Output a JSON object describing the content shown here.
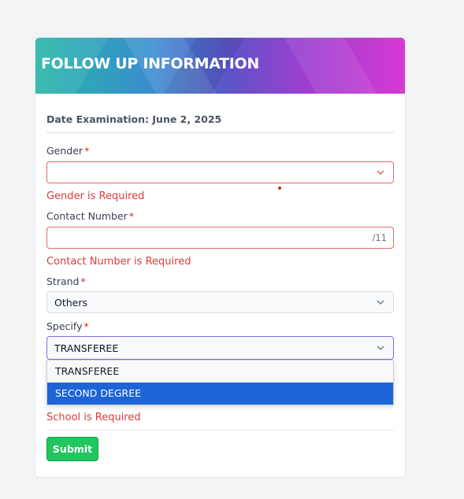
{
  "header": {
    "title": "FOLLOW UP INFORMATION"
  },
  "exam": {
    "date_line": "Date Examination: June 2, 2025"
  },
  "required_marker": "*",
  "gender": {
    "label": "Gender",
    "value": "",
    "error": "Gender is Required"
  },
  "contact": {
    "label": "Contact Number",
    "value": "",
    "counter": "/11",
    "error": "Contact Number is Required"
  },
  "strand": {
    "label": "Strand",
    "value": "Others"
  },
  "specify": {
    "label": "Specify",
    "value": "TRANSFEREE",
    "options": [
      "TRANSFEREE",
      "SECOND DEGREE"
    ],
    "highlighted_index": 1
  },
  "school": {
    "error": "School is Required"
  },
  "submit_label": "Submit",
  "colors": {
    "error": "#dc3b3b",
    "focus_border": "#7b6ee6",
    "highlight": "#1d64d8",
    "submit": "#22c55e"
  },
  "icons": {
    "select_caret": "chevron-down-icon"
  }
}
